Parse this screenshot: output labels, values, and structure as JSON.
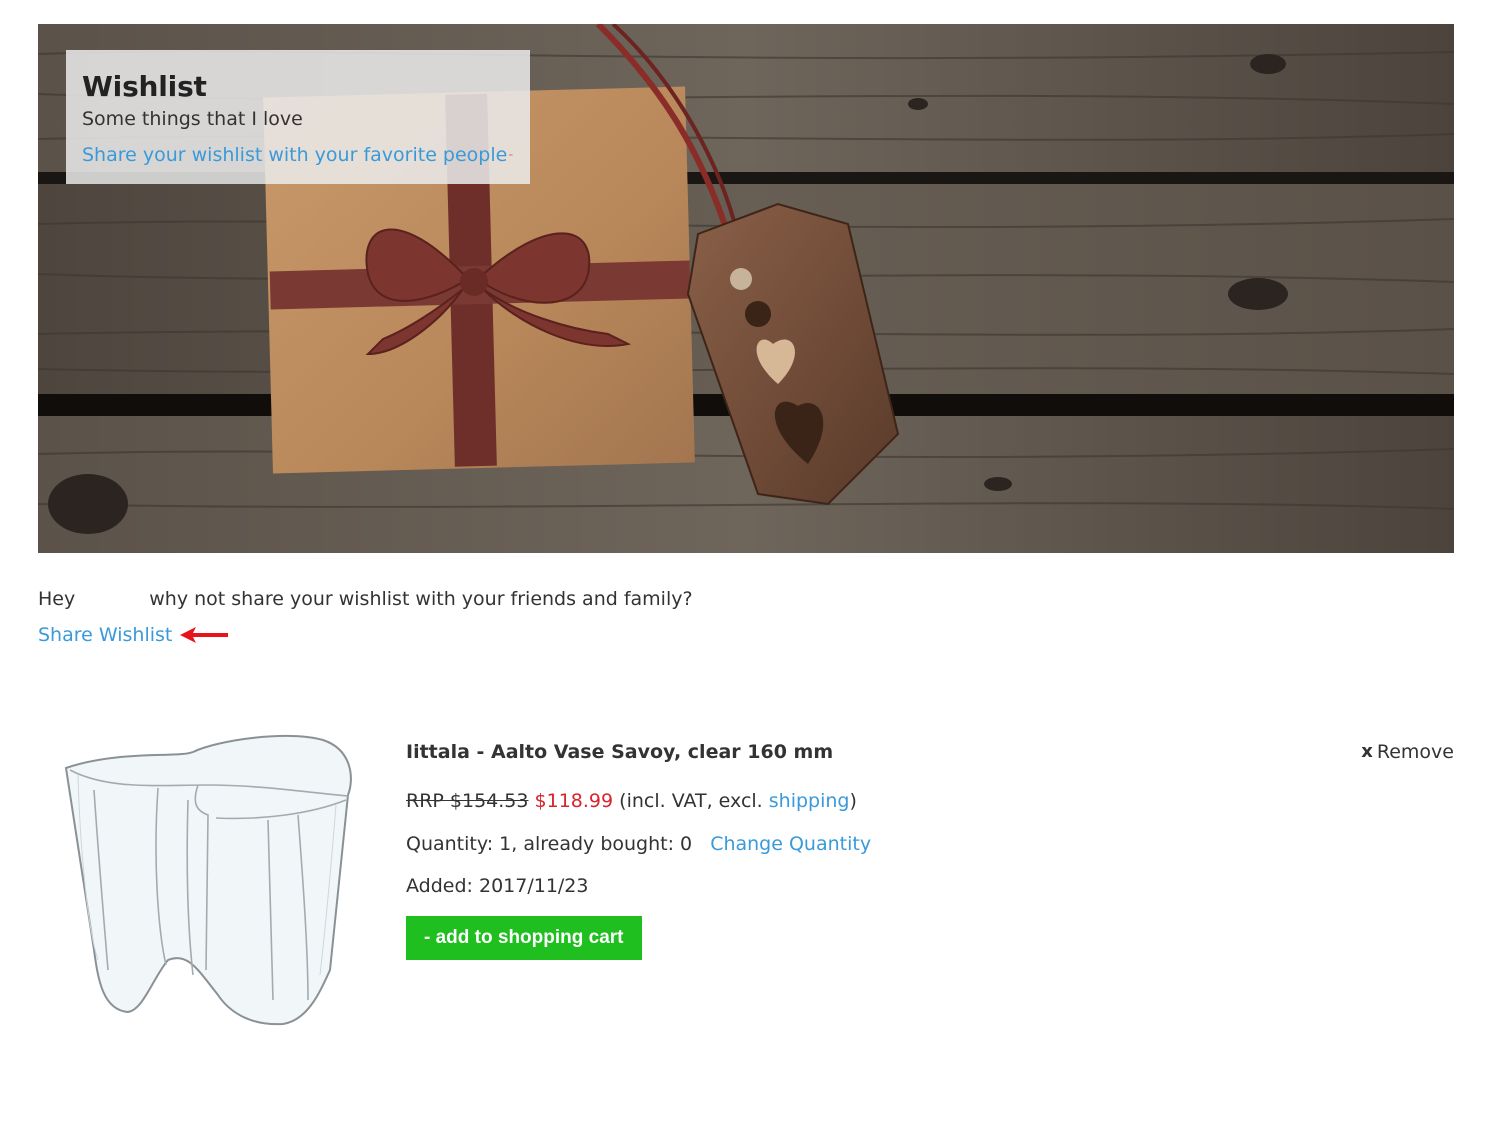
{
  "hero": {
    "title": "Wishlist",
    "subtitle": "Some things that I love",
    "share_link": "Share your wishlist with your favorite people"
  },
  "share": {
    "intro_hey": "Hey",
    "intro_rest": "why not share your wishlist with your friends and family?",
    "link": "Share Wishlist"
  },
  "item": {
    "title": "Iittala - Aalto Vase Savoy, clear 160 mm",
    "remove_icon": "x",
    "remove_label": "Remove",
    "rrp": "RRP $154.53",
    "price": "$118.99",
    "vat_prefix": "(incl. VAT, excl.",
    "shipping_link": "shipping",
    "vat_suffix": ")",
    "quantity_text": "Quantity: 1, already bought: 0",
    "change_quantity": "Change Quantity",
    "added": "Added: 2017/11/23",
    "add_to_cart": "- add to shopping cart"
  },
  "icons": {
    "hero_arrow": "red-arrow-icon",
    "share_arrow": "red-arrow-icon",
    "remove": "close-icon"
  },
  "colors": {
    "link": "#3a9ad9",
    "price": "#d9232d",
    "cart_button": "#1fbf1f",
    "annotation_arrow": "#e8141b"
  }
}
